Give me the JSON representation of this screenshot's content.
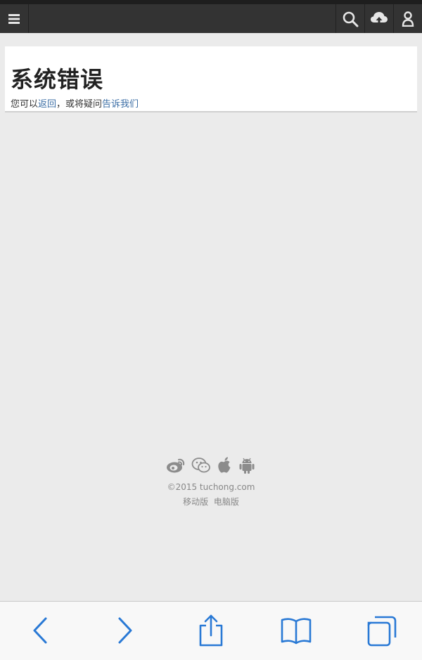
{
  "topbar": {
    "menu_icon": "menu-icon",
    "search_icon": "search-icon",
    "upload_icon": "cloud-upload-icon",
    "user_icon": "user-icon",
    "background": "#333333"
  },
  "error": {
    "title": "系统错误",
    "msg_prefix": "您可以",
    "back_link": "返回",
    "msg_middle": "，或将疑问",
    "report_link": "告诉我们"
  },
  "footer": {
    "social_icons": [
      "weibo-icon",
      "wechat-icon",
      "apple-icon",
      "android-icon"
    ],
    "copyright": "©2015 tuchong.com",
    "mobile_version": "移动版",
    "desktop_version": "电脑版"
  },
  "browser_toolbar": {
    "icons": [
      "back-icon",
      "forward-icon",
      "share-icon",
      "bookmarks-icon",
      "tabs-icon"
    ],
    "accent": "#2979d5"
  }
}
